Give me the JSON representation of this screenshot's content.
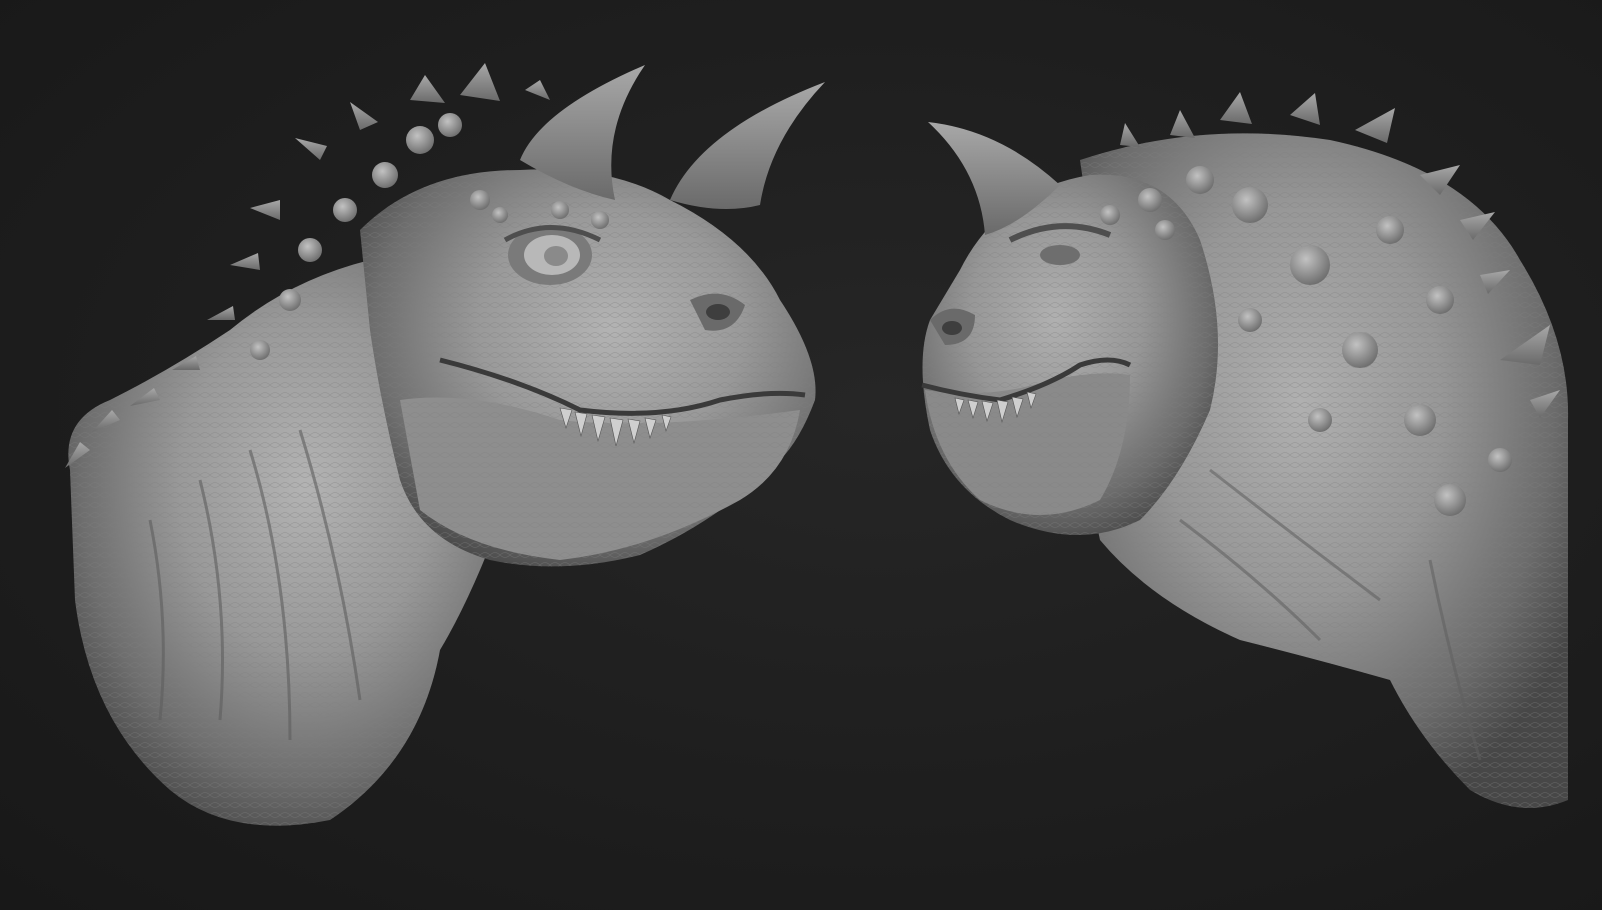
{
  "scene": {
    "background_color": "#1e1e1e",
    "material_color": "#9a9a9a",
    "subjects": [
      {
        "name": "creature-bust-left",
        "view": "three-quarter-right"
      },
      {
        "name": "creature-bust-right",
        "view": "three-quarter-left"
      }
    ]
  }
}
